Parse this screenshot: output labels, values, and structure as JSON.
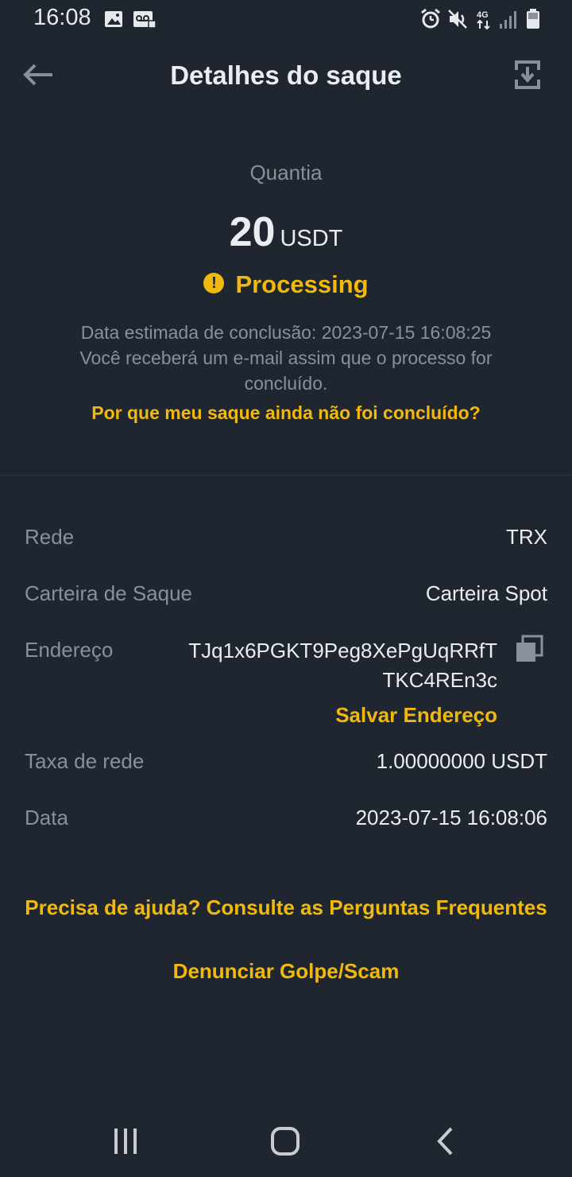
{
  "status_bar": {
    "time": "16:08",
    "network": "4G"
  },
  "app_bar": {
    "title": "Detalhes do saque"
  },
  "summary": {
    "amount_label": "Quantia",
    "amount_value": "20",
    "amount_unit": "USDT",
    "status": "Processing",
    "status_icon": "warning-icon",
    "note_line1": "Data estimada de conclusão: 2023-07-15 16:08:25",
    "note_line2": "Você receberá um e-mail assim que o processo for concluído.",
    "why_link": "Por que meu saque ainda não foi concluído?"
  },
  "details": {
    "network_label": "Rede",
    "network_value": "TRX",
    "wallet_label": "Carteira de Saque",
    "wallet_value": "Carteira Spot",
    "address_label": "Endereço",
    "address_line1": "TJq1x6PGKT9Peg8XePgUqRRfT",
    "address_line2": "TKC4REn3c",
    "save_address": "Salvar Endereço",
    "fee_label": "Taxa de rede",
    "fee_value": "1.00000000 USDT",
    "date_label": "Data",
    "date_value": "2023-07-15 16:08:06"
  },
  "links": {
    "help": "Precisa de ajuda? Consulte as Perguntas Frequentes",
    "report": "Denunciar Golpe/Scam"
  },
  "colors": {
    "background": "#1f2630",
    "accent": "#f0b90b",
    "muted": "#8a9099",
    "text": "#eaecef"
  }
}
